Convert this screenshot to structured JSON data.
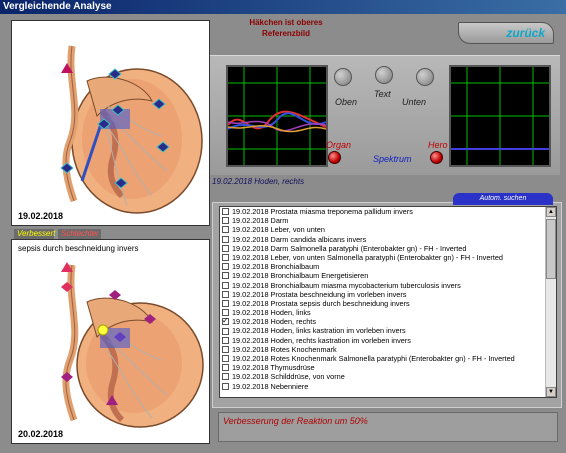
{
  "window": {
    "title": "Vergleichende Analyse"
  },
  "header": {
    "reference_note_line1": "Häkchen ist oberes",
    "reference_note_line2": "Referenzbild",
    "back_button": "zurück"
  },
  "left_panel": {
    "top_image_date": "19.02.2018",
    "tab_better": "Verbessert",
    "tab_worse": "Schlechter",
    "bottom_caption": "sepsis durch beschneidung invers",
    "bottom_image_date": "20.02.2018"
  },
  "controls": {
    "knob_labels": [
      "Oben",
      "Text",
      "Unten"
    ],
    "led_organ": "Organ",
    "spectrum": "Spektrum",
    "led_hero": "Hero"
  },
  "context_line": "19.02.2018 Hoden, rechts",
  "auto_search_button": "Autom. suchen",
  "list_items": [
    {
      "text": "19.02.2018  Prostata  miasma treponema pallidum invers",
      "checked": false
    },
    {
      "text": "19.02.2018  Darm",
      "checked": false
    },
    {
      "text": "19.02.2018  Leber, von unten",
      "checked": false
    },
    {
      "text": "19.02.2018  Darm  candida albicans invers",
      "checked": false
    },
    {
      "text": "19.02.2018  Darm  Salmonella paratyphi (Enterobakter gn) - FH - Inverted",
      "checked": false
    },
    {
      "text": "19.02.2018  Leber, von unten  Salmonella paratyphi (Enterobakter gn) - FH - Inverted",
      "checked": false
    },
    {
      "text": "19.02.2018  Bronchialbaum",
      "checked": false
    },
    {
      "text": "19.02.2018  Bronchialbaum  Energetisieren",
      "checked": false
    },
    {
      "text": "19.02.2018  Bronchialbaum  miasma mycobacterium tuberculosis invers",
      "checked": false
    },
    {
      "text": "19.02.2018  Prostata  beschneidung im vorleben invers",
      "checked": false
    },
    {
      "text": "19.02.2018  Prostata  sepsis durch beschneidung invers",
      "checked": false
    },
    {
      "text": "19.02.2018  Hoden, links",
      "checked": false
    },
    {
      "text": "19.02.2018  Hoden, rechts",
      "checked": true
    },
    {
      "text": "19.02.2018  Hoden, links  kastration im vorleben invers",
      "checked": false
    },
    {
      "text": "19.02.2018  Hoden, rechts  kastration im vorleben invers",
      "checked": false
    },
    {
      "text": "19.02.2018  Rotes Knochenmark",
      "checked": false
    },
    {
      "text": "19.02.2018  Rotes Knochenmark  Salmonella paratyphi (Enterobakter gn) - FH - Inverted",
      "checked": false
    },
    {
      "text": "19.02.2018  Thymusdrüse",
      "checked": false
    },
    {
      "text": "19.02.2018  Schilddrüse, von vorne",
      "checked": false
    },
    {
      "text": "19.02.2018  Nebenniere",
      "checked": false
    }
  ],
  "result_text": "Verbesserung der Reaktion um 50%",
  "colors": {
    "title_bar": "#0a246a",
    "accent_blue": "#2a32c8",
    "led_red": "#c00000",
    "scope_grid": "#00c000"
  }
}
